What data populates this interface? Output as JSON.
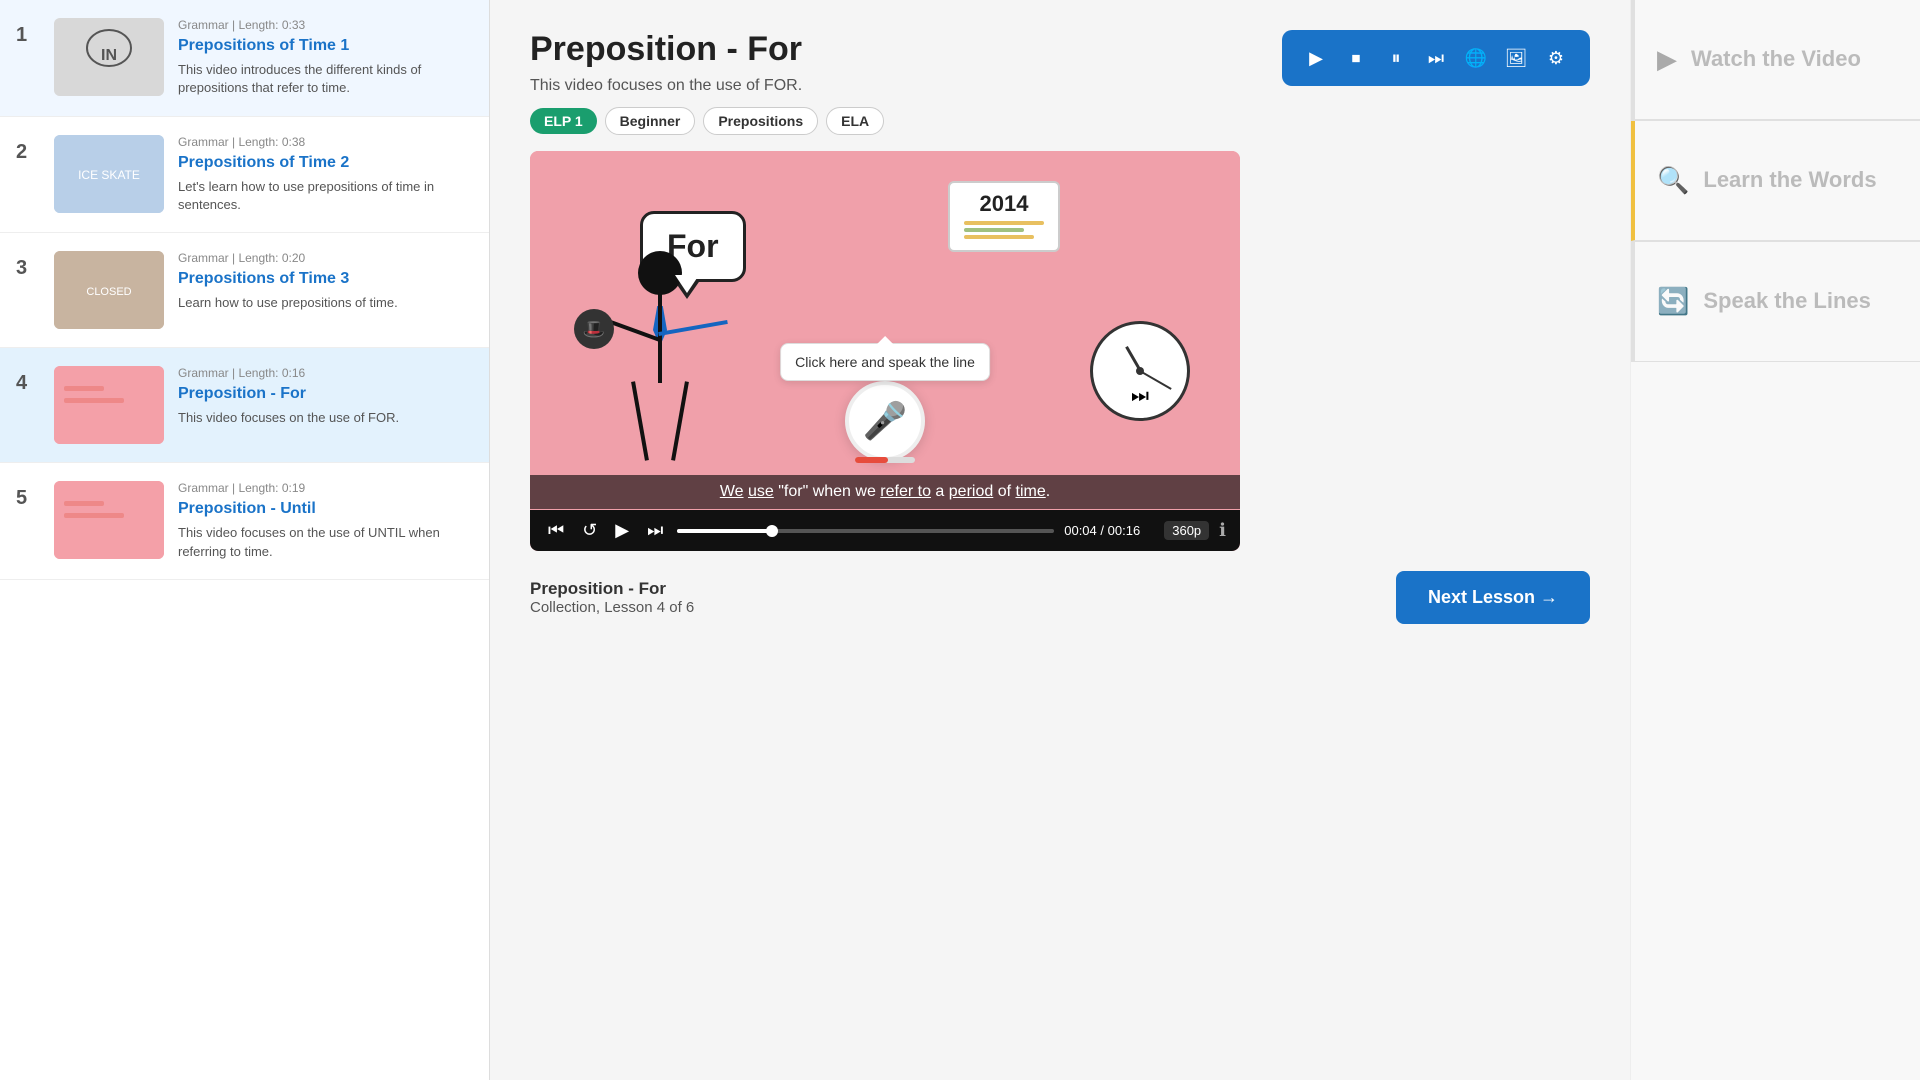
{
  "sidebar": {
    "lessons": [
      {
        "number": "1",
        "tag": "Grammar | Length: 0:33",
        "title": "Prepositions of Time 1",
        "desc": "This video introduces the different kinds of prepositions that refer to time.",
        "active": false,
        "thumbColor": "#d8d8d8"
      },
      {
        "number": "2",
        "tag": "Grammar | Length: 0:38",
        "title": "Prepositions of Time 2",
        "desc": "Let's learn how to use prepositions of time in sentences.",
        "active": false,
        "thumbColor": "#b0c4de"
      },
      {
        "number": "3",
        "tag": "Grammar | Length: 0:20",
        "title": "Prepositions of Time 3",
        "desc": "Learn how to use prepositions of time.",
        "active": false,
        "thumbColor": "#c8b4a0"
      },
      {
        "number": "4",
        "tag": "Grammar | Length: 0:16",
        "title": "Preposition - For",
        "desc": "This video focuses on the use of FOR.",
        "active": true,
        "thumbColor": "#f4a0a8"
      },
      {
        "number": "5",
        "tag": "Grammar | Length: 0:19",
        "title": "Preposition - Until",
        "desc": "This video focuses on the use of UNTIL when referring to time.",
        "active": false,
        "thumbColor": "#f4a0a8"
      }
    ]
  },
  "header": {
    "title": "Preposition - For",
    "subtitle": "This video focuses on the use of FOR.",
    "tags": [
      "ELP 1",
      "Beginner",
      "Prepositions",
      "ELA"
    ]
  },
  "toolbar": {
    "icons": [
      "▶",
      "⏹",
      "⏸",
      "⏭",
      "🌐",
      "🖼",
      "⚙"
    ]
  },
  "video": {
    "speech_bubble_text": "For",
    "subtitle": "We use \"for\" when we refer to a period of time.",
    "mic_tooltip": "Click here and speak the line",
    "time_current": "00:04",
    "time_total": "00:16",
    "quality": "360p",
    "year_card": "2014",
    "progress_percent": 25
  },
  "right_panel": {
    "sections": [
      {
        "label": "Watch the Video",
        "icon": "▶"
      },
      {
        "label": "Learn the Words",
        "icon": "🔍"
      },
      {
        "label": "Speak the Lines",
        "icon": "🔄"
      }
    ]
  },
  "bottom": {
    "lesson_title": "Preposition - For",
    "lesson_info": "Collection, Lesson 4 of 6",
    "next_button": "Next Lesson →"
  }
}
